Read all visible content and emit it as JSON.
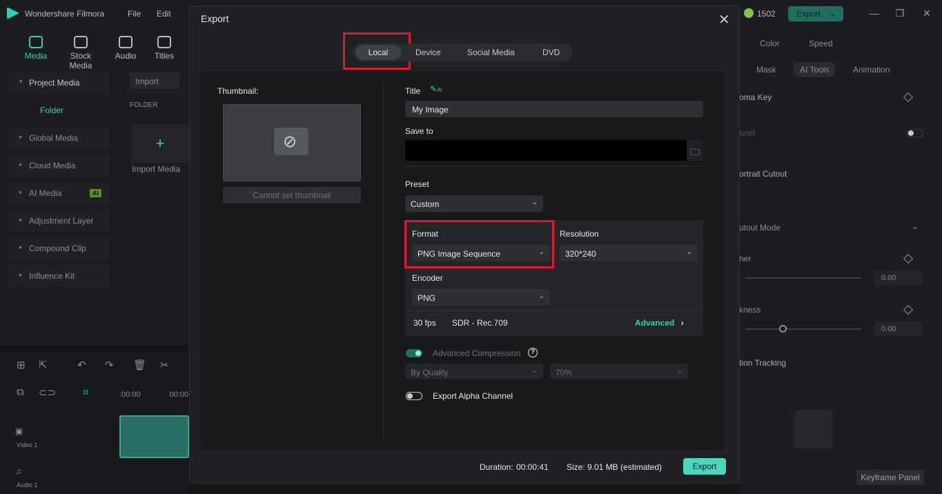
{
  "app": {
    "title": "Wondershare Filmora",
    "menu": [
      "File",
      "Edit"
    ],
    "credits": "1502",
    "export_label": "Export"
  },
  "toolbar": {
    "items": [
      {
        "label": "Media"
      },
      {
        "label": "Stock Media"
      },
      {
        "label": "Audio"
      },
      {
        "label": "Titles"
      }
    ]
  },
  "media_panel": {
    "nav": [
      "Project Media",
      "Global Media",
      "Cloud Media",
      "AI Media",
      "Adjustment Layer",
      "Compound Clip",
      "Influence Kit"
    ],
    "folder_sub": "Folder",
    "ai_badge": "AI",
    "import_label": "Import",
    "folder_label": "FOLDER",
    "import_media_label": "Import Media"
  },
  "timeline": {
    "time": ":00:00",
    "time2": "00:00",
    "video_track": "Video 1",
    "audio_track": "Audio 1"
  },
  "right_panel": {
    "tabs": [
      "Color",
      "Speed"
    ],
    "subtabs": [
      "Mask",
      "AI Tools",
      "Animation"
    ],
    "chroma_key": "oma Key",
    "channel": "nnel",
    "portrait_cutout": "ortrait Cutout",
    "cutout_mode": "utout Mode",
    "feather": "her",
    "feather_value": "0.00",
    "thickness": "kness",
    "thickness_value": "0.00",
    "motion_tracking": "tion Tracking",
    "keyframe_panel": "Keyframe Panel"
  },
  "export_dialog": {
    "title": "Export",
    "tabs": [
      "Local",
      "Device",
      "Social Media",
      "DVD"
    ],
    "active_tab": "Local",
    "thumbnail": {
      "label": "Thumbnail:",
      "button": "Cannot set thumbnail"
    },
    "title_field": {
      "label": "Title",
      "ai_label": "AI",
      "value": "My Image"
    },
    "save_to": {
      "label": "Save to",
      "value": ""
    },
    "preset": {
      "label": "Preset",
      "value": "Custom"
    },
    "format": {
      "label": "Format",
      "value": "PNG Image Sequence"
    },
    "resolution": {
      "label": "Resolution",
      "value": "320*240"
    },
    "encoder": {
      "label": "Encoder",
      "value": "PNG"
    },
    "fps": "30 fps",
    "color_space": "SDR - Rec.709",
    "advanced_label": "Advanced",
    "advanced_compression": {
      "label": "Advanced Compression",
      "enabled": true,
      "mode": "By Quality",
      "quality": "70%"
    },
    "alpha_channel": {
      "label": "Export Alpha Channel",
      "enabled": false
    },
    "duration_label": "Duration:",
    "duration_value": "00:00:41",
    "size_label": "Size:",
    "size_value": "9.01 MB (estimated)",
    "export_button": "Export"
  },
  "colors": {
    "accent": "#2fd0b5",
    "highlight": "#e0182d",
    "export_button": "#4ad6bc"
  }
}
